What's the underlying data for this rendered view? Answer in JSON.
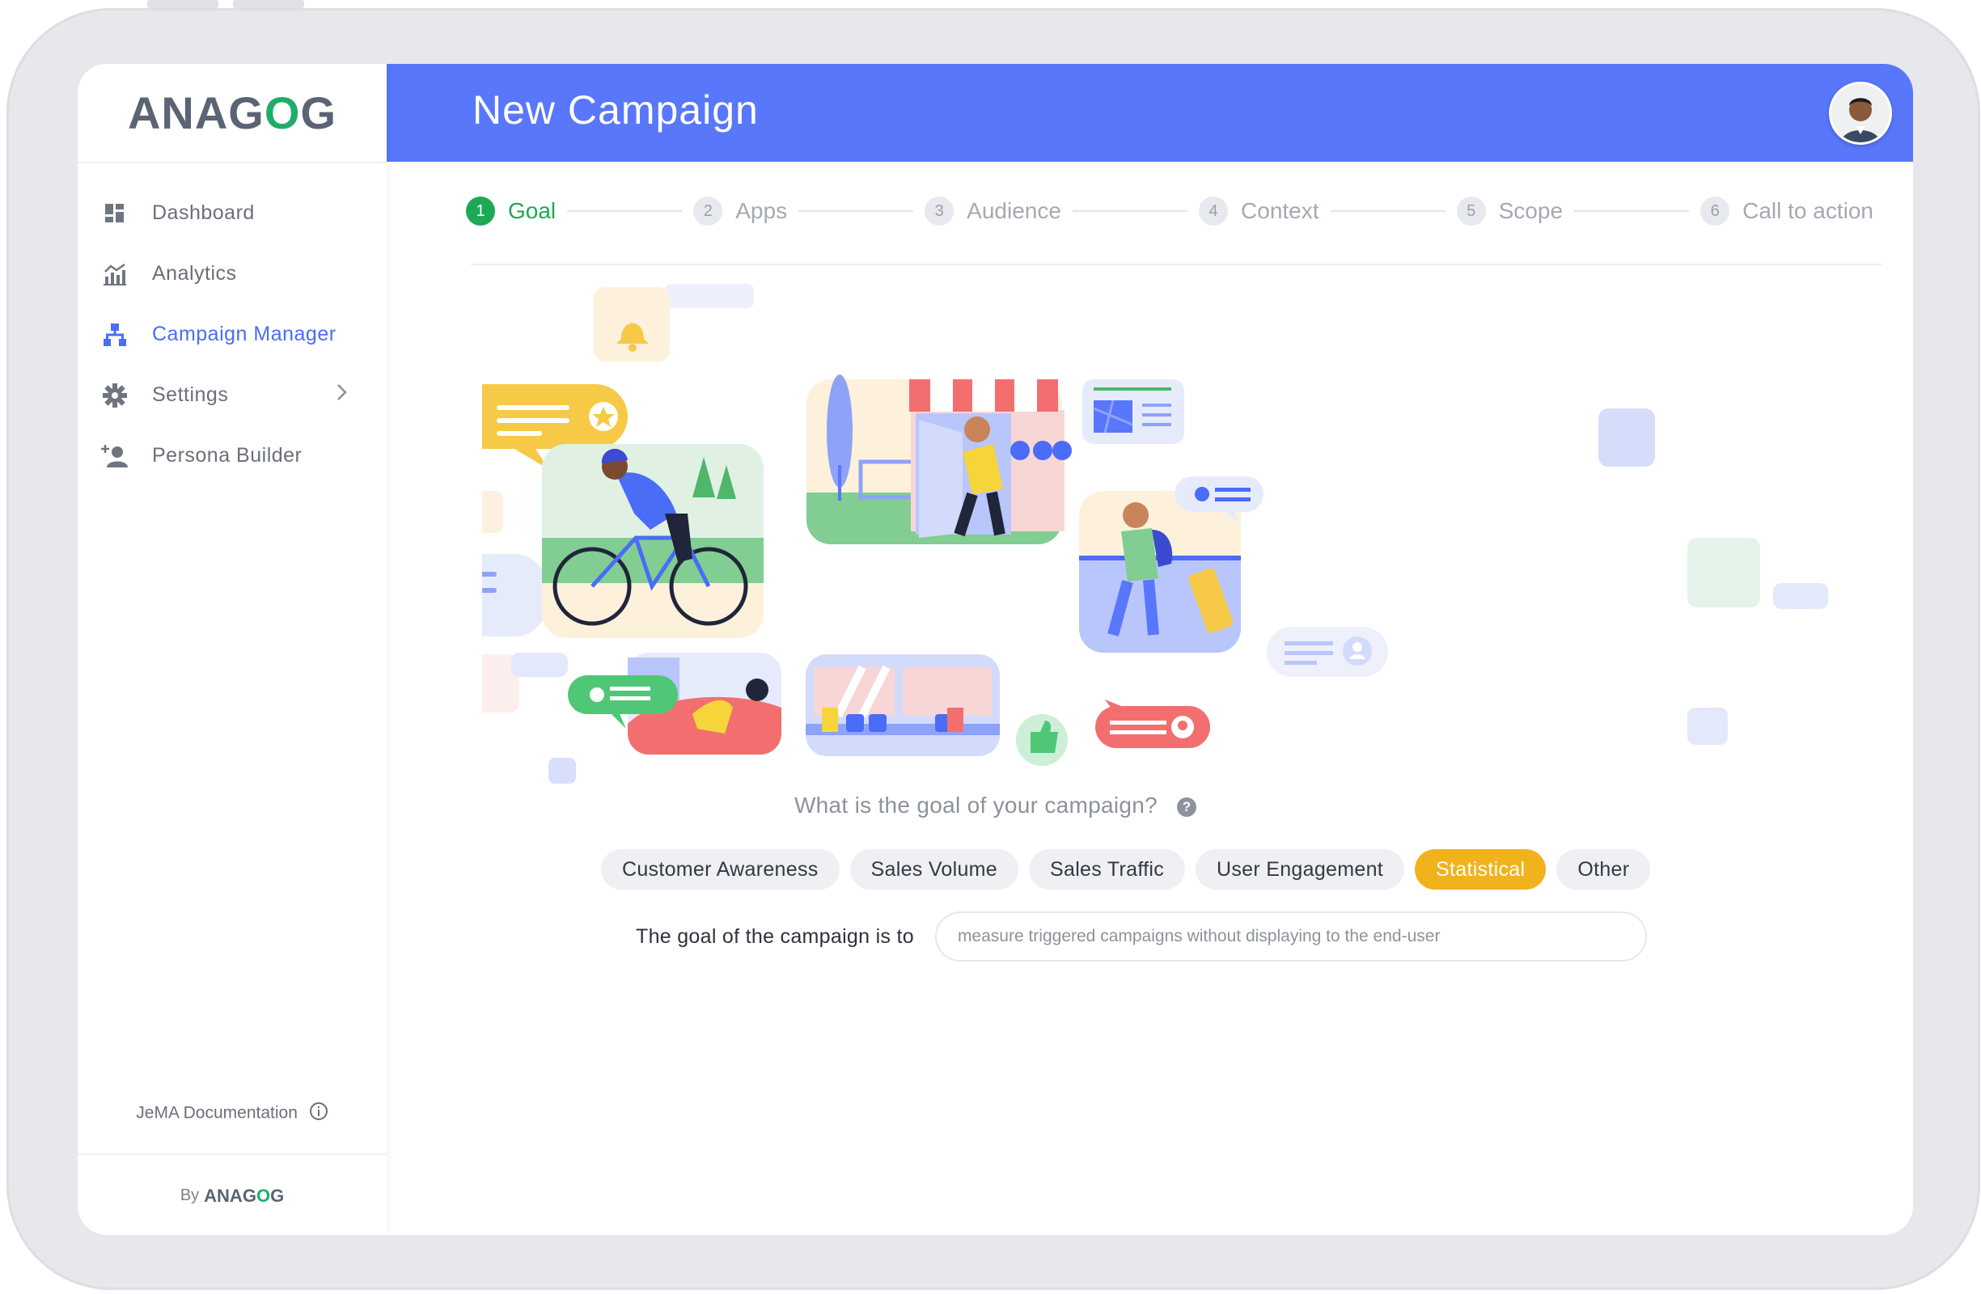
{
  "brand": {
    "logo_prefix": "ANAG",
    "logo_o": "O",
    "logo_suffix": "G"
  },
  "sidebar": {
    "items": [
      {
        "label": "Dashboard",
        "icon": "dashboard-icon"
      },
      {
        "label": "Analytics",
        "icon": "analytics-icon"
      },
      {
        "label": "Campaign Manager",
        "icon": "hierarchy-icon",
        "active": true
      },
      {
        "label": "Settings",
        "icon": "gear-icon",
        "has_submenu": true
      },
      {
        "label": "Persona Builder",
        "icon": "add-user-icon"
      }
    ],
    "doc_link": "JeMA Documentation",
    "footer_by": "By",
    "footer_brand_prefix": "ANAG",
    "footer_brand_o": "O",
    "footer_brand_suffix": "G"
  },
  "header": {
    "title": "New Campaign"
  },
  "steps": [
    {
      "num": "1",
      "label": "Goal",
      "active": true
    },
    {
      "num": "2",
      "label": "Apps"
    },
    {
      "num": "3",
      "label": "Audience"
    },
    {
      "num": "4",
      "label": "Context"
    },
    {
      "num": "5",
      "label": "Scope"
    },
    {
      "num": "6",
      "label": "Call to action"
    }
  ],
  "question": {
    "text": "What is the goal of your campaign?",
    "help": "?"
  },
  "goals": {
    "options": [
      "Customer Awareness",
      "Sales Volume",
      "Sales Traffic",
      "User Engagement",
      "Statistical",
      "Other"
    ],
    "selected": "Statistical"
  },
  "goal_sentence": {
    "label": "The goal of the campaign is to",
    "value": "measure triggered campaigns without displaying to the end-user"
  },
  "colors": {
    "header": "#5877fb",
    "accent": "#4a6cf7",
    "success": "#1ea856",
    "selected_chip": "#f2b21b"
  }
}
